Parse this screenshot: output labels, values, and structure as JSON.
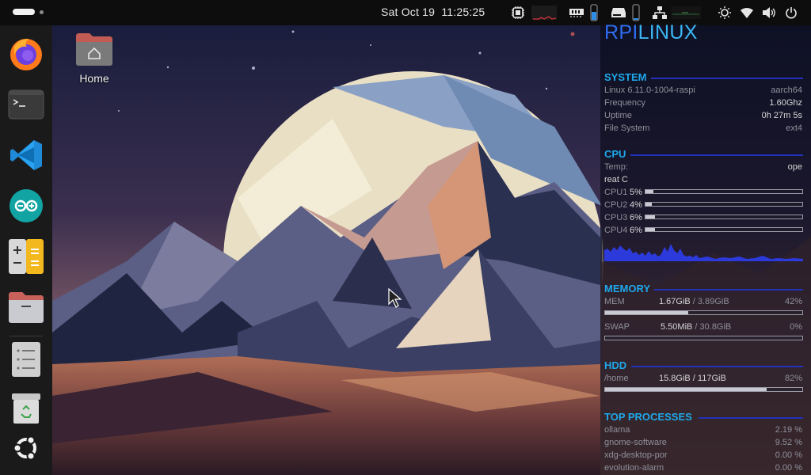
{
  "topbar": {
    "clock": "Sat Oct 19  11:25:25"
  },
  "tray_icons": [
    "cpu-chip-icon",
    "memory-icon",
    "battery-icon",
    "drive-icon",
    "network-tree-icon",
    "brightness-icon",
    "wifi-icon",
    "volume-icon",
    "power-icon"
  ],
  "dock": {
    "apps": [
      "firefox-icon",
      "terminal-icon",
      "vscode-icon",
      "arduino-icon",
      "calculator-icon",
      "files-icon",
      "show-apps-icon",
      "trash-icon",
      "ubuntu-logo-icon"
    ]
  },
  "desktop": {
    "home_label": "Home"
  },
  "conky": {
    "logo_a": "RPI",
    "logo_b": "LINUX",
    "system": {
      "title": "SYSTEM",
      "kernel": "Linux 6.11.0-1004-raspi",
      "arch": "aarch64",
      "frequency_label": "Frequency",
      "frequency": "1.60Ghz",
      "uptime_label": "Uptime",
      "uptime": "0h 27m 5s",
      "fs_label": "File System",
      "fs": "ext4"
    },
    "cpu": {
      "title": "CPU",
      "temp_label": "Temp:",
      "temp_value": "ope",
      "temp_extra": "reat C",
      "cores": [
        {
          "label": "CPU1",
          "pct": "5%",
          "load": 0.05
        },
        {
          "label": "CPU2",
          "pct": "4%",
          "load": 0.04
        },
        {
          "label": "CPU3",
          "pct": "6%",
          "load": 0.06
        },
        {
          "label": "CPU4",
          "pct": "6%",
          "load": 0.06
        }
      ]
    },
    "memory": {
      "title": "MEMORY",
      "mem_label": "MEM",
      "mem_used": "1.67GiB",
      "mem_total": " / 3.89GiB",
      "mem_pct": "42%",
      "mem_load": 0.42,
      "swap_label": "SWAP",
      "swap_used": "5.50MiB",
      "swap_total": " / 30.8GiB",
      "swap_pct": "0%",
      "swap_load": 0.0
    },
    "hdd": {
      "title": "HDD",
      "mount": "/home",
      "usage": "15.8GiB / 117GiB",
      "pct": "82%",
      "load": 0.82
    },
    "top": {
      "title": "TOP PROCESSES",
      "procs": [
        {
          "name": "ollama",
          "cpu": "2.19 %"
        },
        {
          "name": "gnome-software",
          "cpu": "9.52 %"
        },
        {
          "name": "xdg-desktop-por",
          "cpu": "0.00 %"
        },
        {
          "name": "evolution-alarm",
          "cpu": "0.00 %"
        }
      ]
    }
  }
}
